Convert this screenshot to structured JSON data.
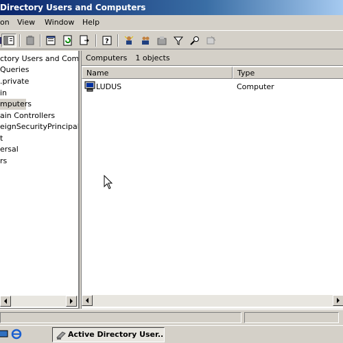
{
  "window": {
    "title": "Directory Users and Computers"
  },
  "menu": {
    "items": [
      "on",
      "View",
      "Window",
      "Help"
    ]
  },
  "tree": {
    "items": [
      {
        "label": "ctory Users and Compu",
        "selected": false
      },
      {
        "label": "Queries",
        "selected": false
      },
      {
        "label": ".private",
        "selected": false
      },
      {
        "label": "in",
        "selected": false
      },
      {
        "label": "mputers",
        "selected": true
      },
      {
        "label": "ain Controllers",
        "selected": false
      },
      {
        "label": "eignSecurityPrincipals",
        "selected": false
      },
      {
        "label": "t",
        "selected": false
      },
      {
        "label": "ersal",
        "selected": false
      },
      {
        "label": "rs",
        "selected": false
      }
    ]
  },
  "details": {
    "container": "Computers",
    "count": "1 objects",
    "columns": {
      "name": "Name",
      "type": "Type"
    },
    "rows": [
      {
        "name": "LUDUS",
        "type": "Computer"
      }
    ]
  },
  "taskbar": {
    "task_label": "Active Directory User..."
  },
  "colors": {
    "title_start": "#0a246a",
    "title_end": "#a6caf0",
    "chrome": "#d4d0c8"
  }
}
